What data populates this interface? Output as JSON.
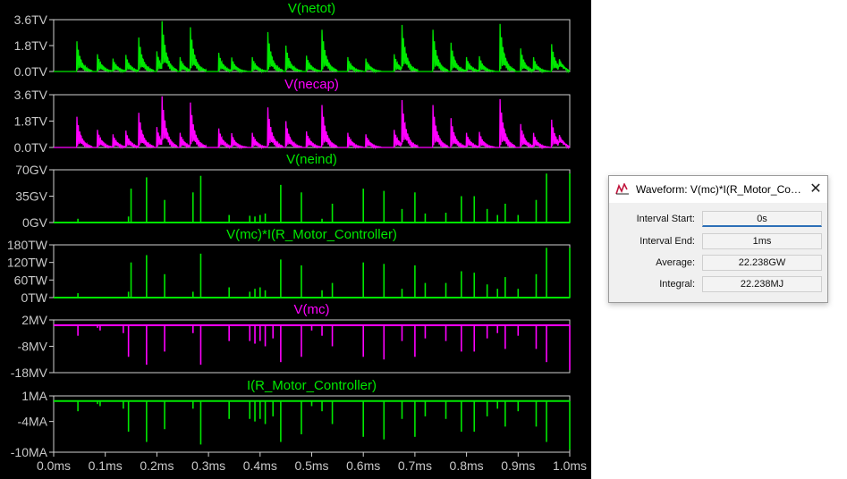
{
  "plot": {
    "x_axis": {
      "ticks": [
        "0.0ms",
        "0.1ms",
        "0.2ms",
        "0.3ms",
        "0.4ms",
        "0.5ms",
        "0.6ms",
        "0.7ms",
        "0.8ms",
        "0.9ms",
        "1.0ms"
      ],
      "range_ms": [
        0,
        1
      ]
    },
    "panes": [
      {
        "title": "V(netot)",
        "color": "#00e800",
        "kind": "decay",
        "y_ticks": [
          "3.6TV",
          "1.8TV",
          "0.0TV"
        ],
        "ylim": [
          0,
          3.6
        ],
        "unit": "TV"
      },
      {
        "title": "V(necap)",
        "color": "#ff00ff",
        "kind": "decay",
        "y_ticks": [
          "3.6TV",
          "1.8TV",
          "0.0TV"
        ],
        "ylim": [
          0,
          3.6
        ],
        "unit": "TV"
      },
      {
        "title": "V(neind)",
        "color": "#00e800",
        "kind": "spikes",
        "y_ticks": [
          "70GV",
          "35GV",
          "0GV"
        ],
        "ylim": [
          0,
          70
        ],
        "unit": "GV"
      },
      {
        "title": "V(mc)*I(R_Motor_Controller)",
        "color": "#00e800",
        "kind": "spikes",
        "y_ticks": [
          "180TW",
          "120TW",
          "60TW",
          "0TW"
        ],
        "ylim": [
          0,
          180
        ],
        "unit": "TW"
      },
      {
        "title": "V(mc)",
        "color": "#ff00ff",
        "kind": "neg_spikes",
        "y_ticks": [
          "2MV",
          "-8MV",
          "-18MV"
        ],
        "ylim": [
          -18,
          2
        ],
        "unit": "MV"
      },
      {
        "title": "I(R_Motor_Controller)",
        "color": "#00e800",
        "kind": "neg_spikes",
        "y_ticks": [
          "1MA",
          "-4MA",
          "-10MA"
        ],
        "ylim": [
          -10,
          1
        ],
        "unit": "MA"
      }
    ],
    "decay_bursts": [
      {
        "t": 0.045,
        "a": 2.1
      },
      {
        "t": 0.085,
        "a": 1.2
      },
      {
        "t": 0.115,
        "a": 0.9
      },
      {
        "t": 0.14,
        "a": 1.1
      },
      {
        "t": 0.165,
        "a": 2.3
      },
      {
        "t": 0.2,
        "a": 1.4
      },
      {
        "t": 0.21,
        "a": 3.3
      },
      {
        "t": 0.245,
        "a": 1.0
      },
      {
        "t": 0.265,
        "a": 3.0
      },
      {
        "t": 0.32,
        "a": 1.3
      },
      {
        "t": 0.345,
        "a": 0.9
      },
      {
        "t": 0.385,
        "a": 1.0
      },
      {
        "t": 0.415,
        "a": 2.7
      },
      {
        "t": 0.45,
        "a": 1.8
      },
      {
        "t": 0.49,
        "a": 1.1
      },
      {
        "t": 0.52,
        "a": 2.9
      },
      {
        "t": 0.57,
        "a": 1.0
      },
      {
        "t": 0.605,
        "a": 0.9
      },
      {
        "t": 0.66,
        "a": 1.2
      },
      {
        "t": 0.675,
        "a": 3.2
      },
      {
        "t": 0.735,
        "a": 2.9
      },
      {
        "t": 0.77,
        "a": 2.0
      },
      {
        "t": 0.8,
        "a": 1.0
      },
      {
        "t": 0.825,
        "a": 1.0
      },
      {
        "t": 0.865,
        "a": 3.3
      },
      {
        "t": 0.905,
        "a": 1.6
      },
      {
        "t": 0.93,
        "a": 0.9
      },
      {
        "t": 0.965,
        "a": 1.9
      },
      {
        "t": 0.98,
        "a": 0.8
      }
    ],
    "pos_spikes_neind": [
      {
        "t": 0.047,
        "v": 5
      },
      {
        "t": 0.145,
        "v": 8
      },
      {
        "t": 0.15,
        "v": 45
      },
      {
        "t": 0.18,
        "v": 60
      },
      {
        "t": 0.215,
        "v": 30
      },
      {
        "t": 0.27,
        "v": 40
      },
      {
        "t": 0.285,
        "v": 62
      },
      {
        "t": 0.34,
        "v": 10
      },
      {
        "t": 0.38,
        "v": 9
      },
      {
        "t": 0.39,
        "v": 8
      },
      {
        "t": 0.4,
        "v": 10
      },
      {
        "t": 0.41,
        "v": 12
      },
      {
        "t": 0.44,
        "v": 50
      },
      {
        "t": 0.48,
        "v": 40
      },
      {
        "t": 0.52,
        "v": 5
      },
      {
        "t": 0.54,
        "v": 25
      },
      {
        "t": 0.6,
        "v": 45
      },
      {
        "t": 0.64,
        "v": 42
      },
      {
        "t": 0.675,
        "v": 18
      },
      {
        "t": 0.7,
        "v": 40
      },
      {
        "t": 0.72,
        "v": 12
      },
      {
        "t": 0.76,
        "v": 13
      },
      {
        "t": 0.79,
        "v": 35
      },
      {
        "t": 0.815,
        "v": 35
      },
      {
        "t": 0.84,
        "v": 18
      },
      {
        "t": 0.86,
        "v": 10
      },
      {
        "t": 0.875,
        "v": 25
      },
      {
        "t": 0.9,
        "v": 10
      },
      {
        "t": 0.935,
        "v": 30
      },
      {
        "t": 0.955,
        "v": 65
      },
      {
        "t": 1.0,
        "v": 65
      }
    ],
    "pos_spikes_power": [
      {
        "t": 0.047,
        "v": 15
      },
      {
        "t": 0.145,
        "v": 20
      },
      {
        "t": 0.15,
        "v": 120
      },
      {
        "t": 0.18,
        "v": 145
      },
      {
        "t": 0.215,
        "v": 80
      },
      {
        "t": 0.27,
        "v": 20
      },
      {
        "t": 0.285,
        "v": 150
      },
      {
        "t": 0.34,
        "v": 35
      },
      {
        "t": 0.38,
        "v": 20
      },
      {
        "t": 0.39,
        "v": 30
      },
      {
        "t": 0.4,
        "v": 35
      },
      {
        "t": 0.41,
        "v": 25
      },
      {
        "t": 0.44,
        "v": 130
      },
      {
        "t": 0.48,
        "v": 110
      },
      {
        "t": 0.52,
        "v": 25
      },
      {
        "t": 0.54,
        "v": 50
      },
      {
        "t": 0.6,
        "v": 120
      },
      {
        "t": 0.64,
        "v": 115
      },
      {
        "t": 0.675,
        "v": 30
      },
      {
        "t": 0.7,
        "v": 110
      },
      {
        "t": 0.72,
        "v": 50
      },
      {
        "t": 0.76,
        "v": 50
      },
      {
        "t": 0.79,
        "v": 90
      },
      {
        "t": 0.815,
        "v": 85
      },
      {
        "t": 0.84,
        "v": 45
      },
      {
        "t": 0.86,
        "v": 30
      },
      {
        "t": 0.875,
        "v": 70
      },
      {
        "t": 0.9,
        "v": 30
      },
      {
        "t": 0.935,
        "v": 80
      },
      {
        "t": 0.955,
        "v": 170
      },
      {
        "t": 1.0,
        "v": 170
      }
    ],
    "neg_spikes_mc": [
      {
        "t": 0.047,
        "v": -4
      },
      {
        "t": 0.085,
        "v": -1
      },
      {
        "t": 0.09,
        "v": -2
      },
      {
        "t": 0.135,
        "v": -3
      },
      {
        "t": 0.145,
        "v": -12
      },
      {
        "t": 0.18,
        "v": -15
      },
      {
        "t": 0.215,
        "v": -10
      },
      {
        "t": 0.27,
        "v": -3
      },
      {
        "t": 0.285,
        "v": -15
      },
      {
        "t": 0.34,
        "v": -6
      },
      {
        "t": 0.38,
        "v": -6
      },
      {
        "t": 0.39,
        "v": -7
      },
      {
        "t": 0.4,
        "v": -6
      },
      {
        "t": 0.41,
        "v": -8
      },
      {
        "t": 0.425,
        "v": -5
      },
      {
        "t": 0.44,
        "v": -14
      },
      {
        "t": 0.48,
        "v": -12
      },
      {
        "t": 0.5,
        "v": -2
      },
      {
        "t": 0.52,
        "v": -4
      },
      {
        "t": 0.54,
        "v": -8
      },
      {
        "t": 0.6,
        "v": -12
      },
      {
        "t": 0.64,
        "v": -13
      },
      {
        "t": 0.675,
        "v": -6
      },
      {
        "t": 0.7,
        "v": -12
      },
      {
        "t": 0.72,
        "v": -5
      },
      {
        "t": 0.76,
        "v": -6
      },
      {
        "t": 0.79,
        "v": -10
      },
      {
        "t": 0.815,
        "v": -10
      },
      {
        "t": 0.84,
        "v": -5
      },
      {
        "t": 0.86,
        "v": -3
      },
      {
        "t": 0.875,
        "v": -9
      },
      {
        "t": 0.9,
        "v": -4
      },
      {
        "t": 0.935,
        "v": -9
      },
      {
        "t": 0.955,
        "v": -14
      },
      {
        "t": 1.0,
        "v": -17
      }
    ],
    "neg_spikes_i": [
      {
        "t": 0.047,
        "v": -2
      },
      {
        "t": 0.085,
        "v": -0.6
      },
      {
        "t": 0.09,
        "v": -1
      },
      {
        "t": 0.135,
        "v": -1.5
      },
      {
        "t": 0.145,
        "v": -6
      },
      {
        "t": 0.18,
        "v": -8
      },
      {
        "t": 0.215,
        "v": -5.5
      },
      {
        "t": 0.27,
        "v": -1.5
      },
      {
        "t": 0.285,
        "v": -8.5
      },
      {
        "t": 0.34,
        "v": -3.5
      },
      {
        "t": 0.38,
        "v": -3.5
      },
      {
        "t": 0.39,
        "v": -4
      },
      {
        "t": 0.4,
        "v": -3.5
      },
      {
        "t": 0.41,
        "v": -4.5
      },
      {
        "t": 0.425,
        "v": -3
      },
      {
        "t": 0.44,
        "v": -8
      },
      {
        "t": 0.48,
        "v": -6.5
      },
      {
        "t": 0.5,
        "v": -1
      },
      {
        "t": 0.52,
        "v": -2
      },
      {
        "t": 0.54,
        "v": -4.5
      },
      {
        "t": 0.6,
        "v": -7
      },
      {
        "t": 0.64,
        "v": -7.5
      },
      {
        "t": 0.675,
        "v": -3.5
      },
      {
        "t": 0.7,
        "v": -7
      },
      {
        "t": 0.72,
        "v": -3
      },
      {
        "t": 0.76,
        "v": -3.5
      },
      {
        "t": 0.79,
        "v": -6
      },
      {
        "t": 0.815,
        "v": -6
      },
      {
        "t": 0.84,
        "v": -3
      },
      {
        "t": 0.86,
        "v": -1.5
      },
      {
        "t": 0.875,
        "v": -5
      },
      {
        "t": 0.9,
        "v": -2
      },
      {
        "t": 0.935,
        "v": -5
      },
      {
        "t": 0.955,
        "v": -8
      },
      {
        "t": 1.0,
        "v": -9.5
      }
    ]
  },
  "dialog": {
    "title": "Waveform: V(mc)*I(R_Motor_Con...",
    "close_glyph": "✕",
    "icon": "waveform-app-icon",
    "fields": [
      {
        "label": "Interval Start:",
        "value": "0s"
      },
      {
        "label": "Interval End:",
        "value": "1ms"
      },
      {
        "label": "Average:",
        "value": "22.238GW"
      },
      {
        "label": "Integral:",
        "value": "22.238MJ"
      }
    ]
  }
}
